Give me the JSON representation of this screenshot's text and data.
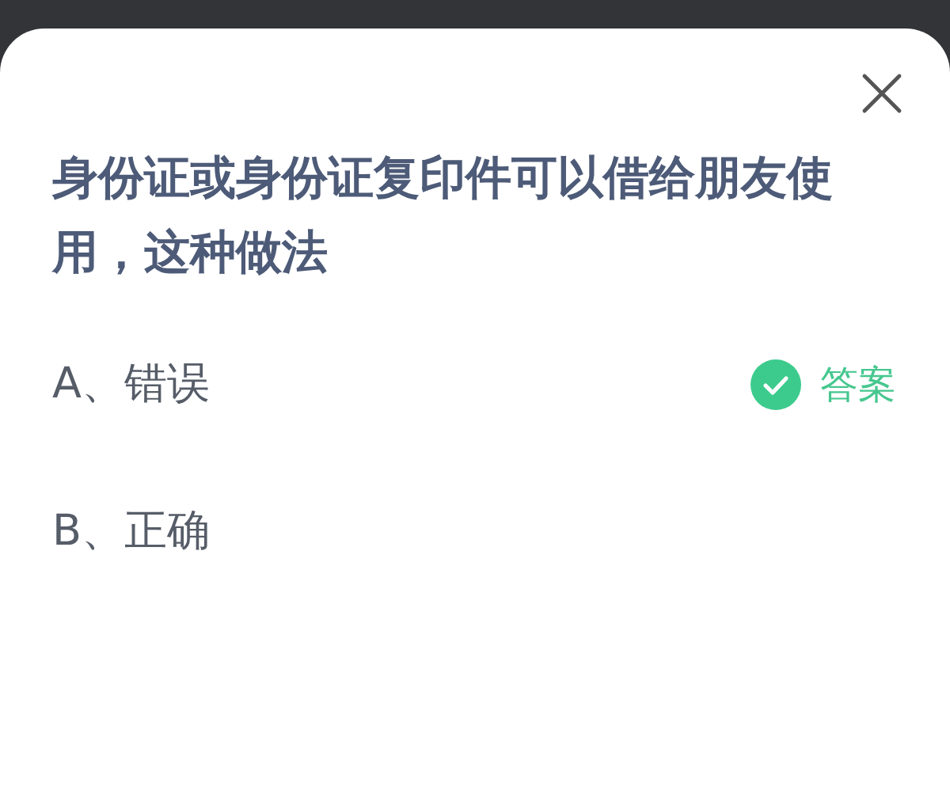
{
  "question": "身份证或身份证复印件可以借给朋友使用，这种做法",
  "options": [
    {
      "label": "A、错误",
      "correct": true
    },
    {
      "label": "B、正确",
      "correct": false
    }
  ],
  "answer_label": "答案"
}
